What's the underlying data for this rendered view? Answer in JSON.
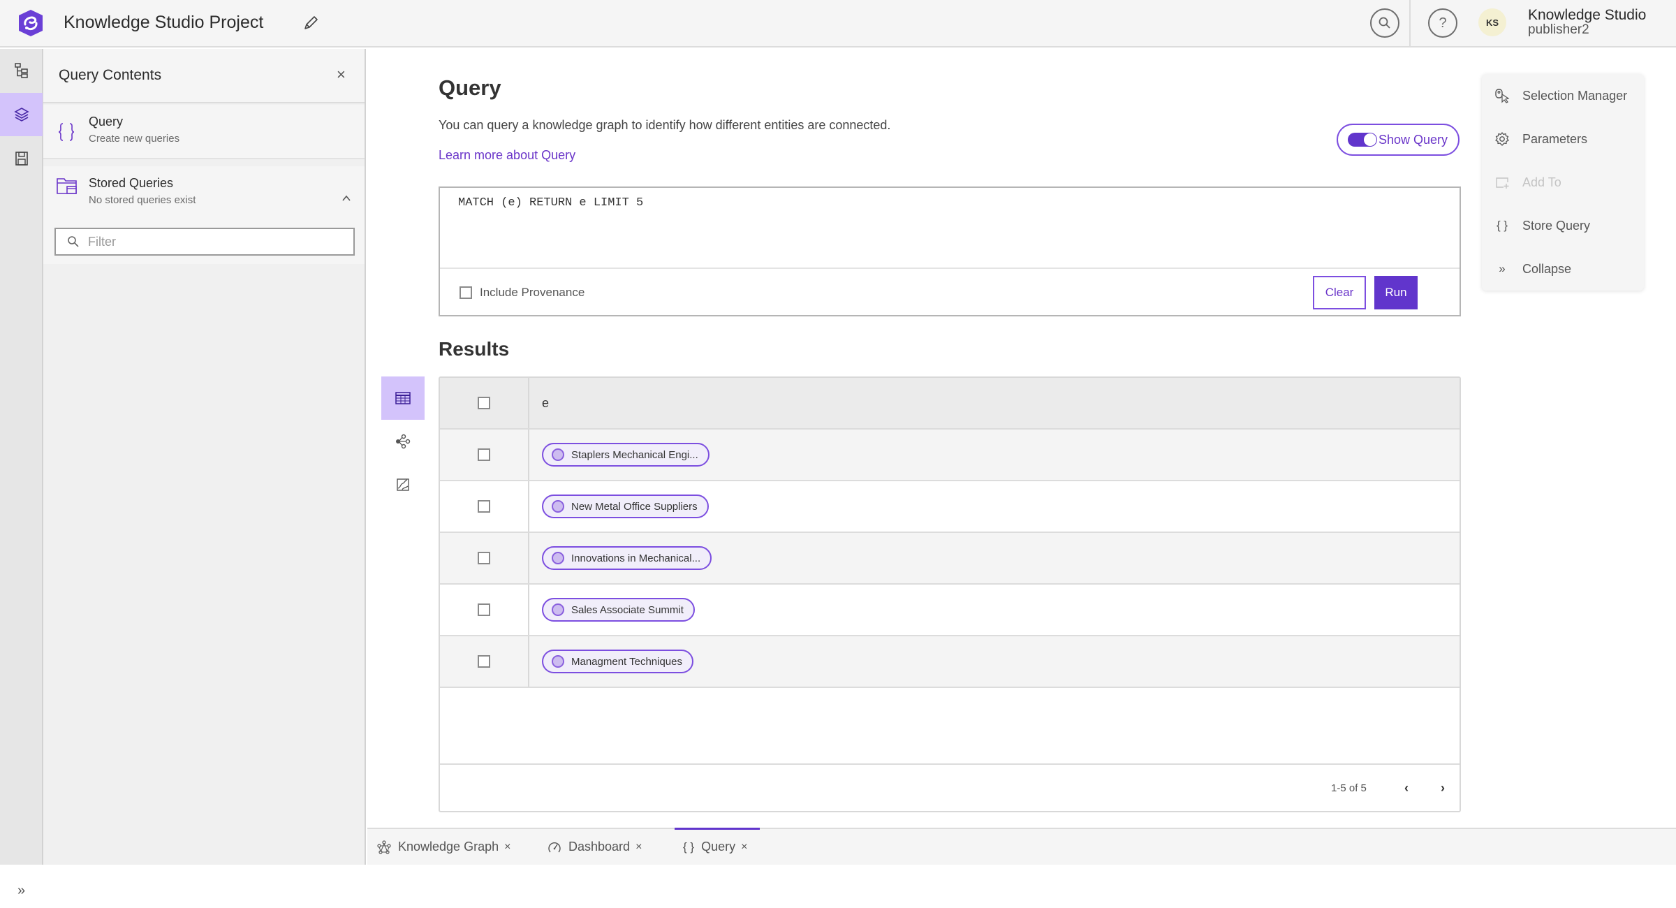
{
  "header": {
    "app_title": "Knowledge Studio Project",
    "user_initials": "KS",
    "user_name": "Knowledge Studio",
    "user_id": "publisher2",
    "accent_color": "#6135cc"
  },
  "rail": {
    "items": [
      {
        "icon": "hierarchy-icon",
        "active": false
      },
      {
        "icon": "layers-icon",
        "active": true
      },
      {
        "icon": "save-icon",
        "active": false
      }
    ],
    "expand_icon": "»"
  },
  "panel": {
    "title": "Query Contents",
    "close_glyph": "×",
    "query_item": {
      "label": "Query",
      "sub": "Create new queries"
    },
    "stored_item": {
      "label": "Stored Queries",
      "sub": "No stored queries exist"
    },
    "filter_placeholder": "Filter"
  },
  "main": {
    "title": "Query",
    "description": "You can query a knowledge graph to identify how different entities are connected.",
    "learn_link": "Learn more about Query",
    "show_query_label": "Show Query",
    "show_query_on": true,
    "query_text": "MATCH (e) RETURN e LIMIT 5",
    "include_provenance_label": "Include Provenance",
    "include_provenance_checked": false,
    "clear_label": "Clear",
    "run_label": "Run",
    "results_title": "Results"
  },
  "results": {
    "column_header": "e",
    "rows": [
      {
        "label": "Staplers Mechanical Engi..."
      },
      {
        "label": "New Metal Office Suppliers"
      },
      {
        "label": "Innovations in Mechanical..."
      },
      {
        "label": "Sales Associate Summit"
      },
      {
        "label": "Managment Techniques"
      }
    ],
    "pager_text": "1-5 of 5",
    "prev_glyph": "‹",
    "next_glyph": "›"
  },
  "tool_menu": {
    "items": [
      {
        "label": "Selection Manager",
        "icon": "selection-manager-icon",
        "enabled": true
      },
      {
        "label": "Parameters",
        "icon": "gear-icon",
        "enabled": true
      },
      {
        "label": "Add To",
        "icon": "add-to-icon",
        "enabled": false
      },
      {
        "label": "Store Query",
        "icon": "braces-icon",
        "enabled": true
      },
      {
        "label": "Collapse",
        "icon": "collapse-icon",
        "enabled": true
      }
    ]
  },
  "tabs": [
    {
      "label": "Knowledge Graph",
      "icon": "knowledge-graph-icon",
      "active": false
    },
    {
      "label": "Dashboard",
      "icon": "dashboard-icon",
      "active": false
    },
    {
      "label": "Query",
      "icon": "braces-icon",
      "active": true
    }
  ],
  "tab_close_glyph": "×"
}
